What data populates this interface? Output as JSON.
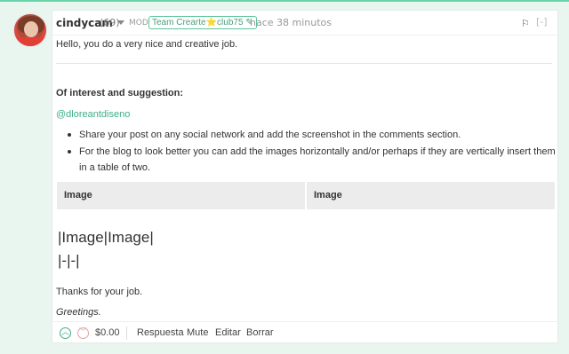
{
  "comment": {
    "author": "cindycam",
    "reputation": "(69)",
    "role_badge": "MOD",
    "team_badge": "Team Crearte",
    "team_star": "⭐",
    "team_club": "club75",
    "time": "hace 38 minutos",
    "collapse_label": "[-]",
    "greeting_line": "Hello, you do a very nice and creative job.",
    "section_title": "Of interest and suggestion:",
    "mention": "@dloreantdiseno",
    "bullets": [
      "Share your post on any social network and add the screenshot in the comments section.",
      "For the blog to look better you can add the images horizontally and/or perhaps if they are vertically insert them in a table of two."
    ],
    "table_headers": [
      "Image",
      "Image"
    ],
    "raw_line1": "|Image|Image|",
    "raw_line2": "|-|-|",
    "thanks": "Thanks for your job.",
    "closing": "Greetings."
  },
  "footer": {
    "payout": "$0.00",
    "actions": [
      "Respuesta",
      "Mute",
      "Editar",
      "Borrar"
    ]
  },
  "colors": {
    "accent": "#3fae86",
    "background": "#e9f5ef"
  },
  "icons": {
    "flag": "flag-icon",
    "upvote": "upvote-icon",
    "downvote": "downvote-icon",
    "caret": "chevron-down-icon"
  }
}
